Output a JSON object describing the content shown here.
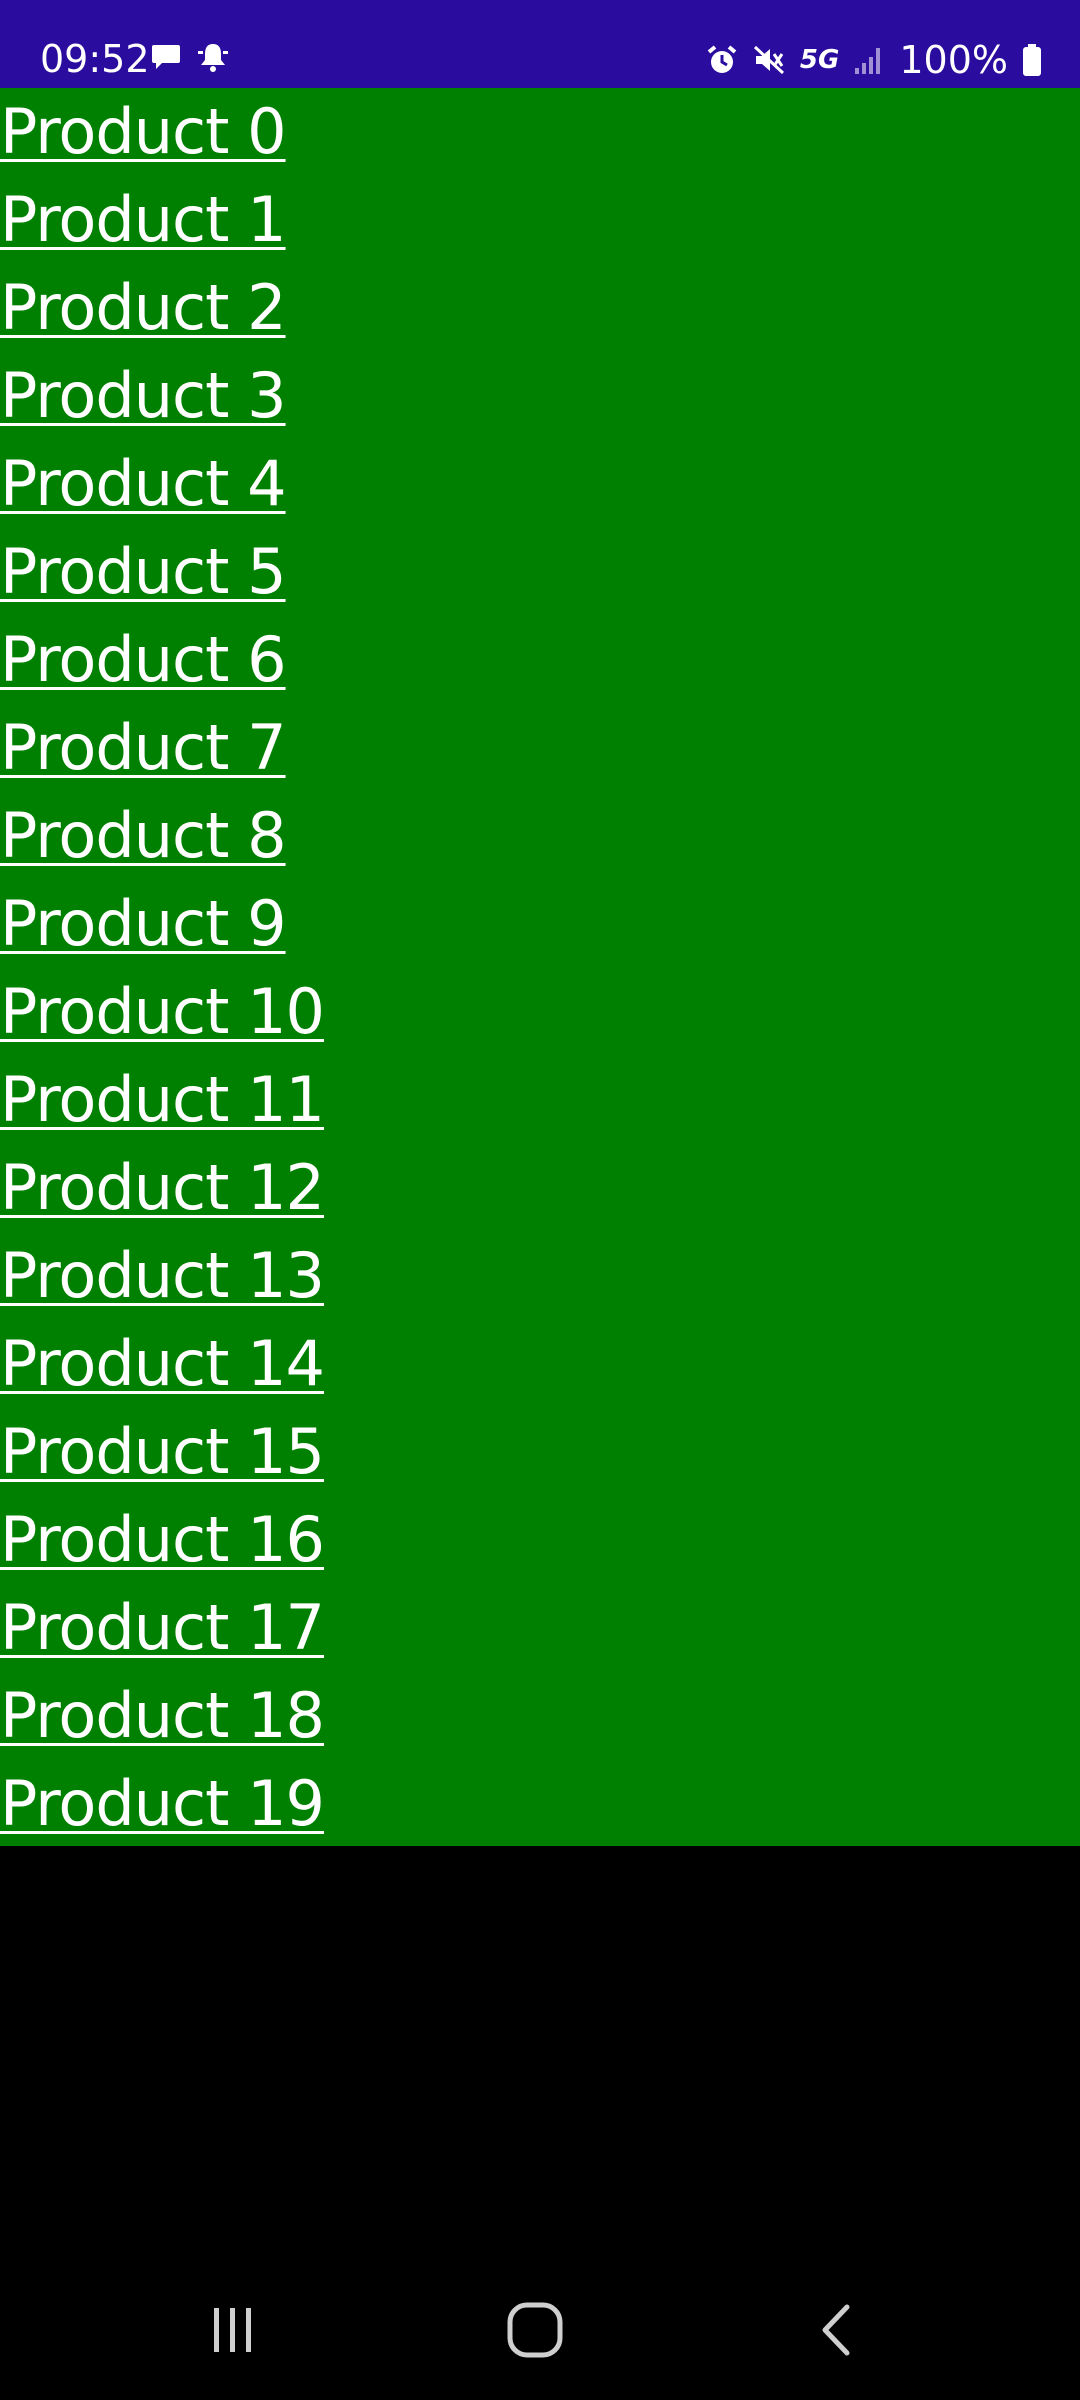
{
  "status_bar": {
    "time": "09:52",
    "left_icons": [
      "chat-bubble-icon",
      "notification-bell-icon"
    ],
    "right_icons": [
      "alarm-icon",
      "vibrate-muted-icon",
      "network-5g-icon",
      "signal-bars-icon",
      "battery-icon"
    ],
    "network_label": "5G",
    "battery_text": "100%",
    "background_color": "#2a0c9e"
  },
  "list": {
    "background_color": "#008000",
    "text_color": "#ffffff",
    "items": [
      {
        "label": "Product 0"
      },
      {
        "label": "Product 1"
      },
      {
        "label": "Product 2"
      },
      {
        "label": "Product 3"
      },
      {
        "label": "Product 4"
      },
      {
        "label": "Product 5"
      },
      {
        "label": "Product 6"
      },
      {
        "label": "Product 7"
      },
      {
        "label": "Product 8"
      },
      {
        "label": "Product 9"
      },
      {
        "label": "Product 10"
      },
      {
        "label": "Product 11"
      },
      {
        "label": "Product 12"
      },
      {
        "label": "Product 13"
      },
      {
        "label": "Product 14"
      },
      {
        "label": "Product 15"
      },
      {
        "label": "Product 16"
      },
      {
        "label": "Product 17"
      },
      {
        "label": "Product 18"
      },
      {
        "label": "Product 19"
      }
    ]
  },
  "nav_bar": {
    "buttons": [
      "recent-apps-icon",
      "home-icon",
      "back-icon"
    ]
  }
}
